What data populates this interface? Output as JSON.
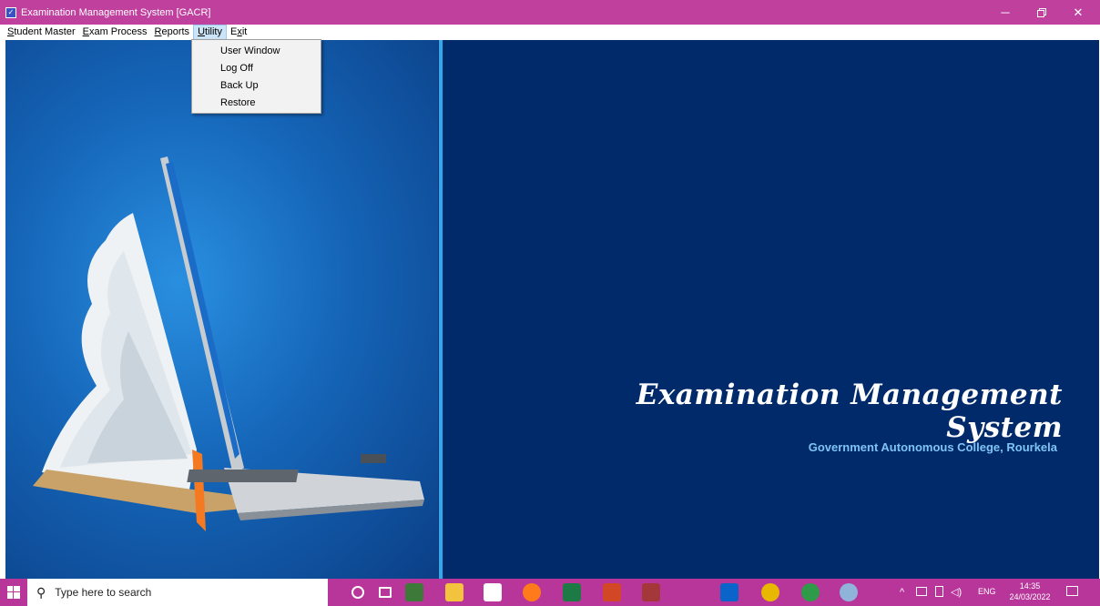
{
  "window": {
    "title": "Examination Management System  [GACR]",
    "controls": [
      "minimize-icon",
      "restore-icon",
      "close-icon"
    ]
  },
  "menubar": {
    "items": [
      {
        "label": "Student Master",
        "accelerator": "S"
      },
      {
        "label": "Exam Process",
        "accelerator": "E"
      },
      {
        "label": "Reports",
        "accelerator": "R"
      },
      {
        "label": "Utility",
        "accelerator": "U",
        "active": true
      },
      {
        "label": "Exit",
        "accelerator": "x"
      }
    ]
  },
  "utility_menu": {
    "items": [
      "User Window",
      "Log Off",
      "Back Up",
      "Restore"
    ]
  },
  "main": {
    "heading": "Examination Management System",
    "subheading": "Government Autonomous College, Rourkela"
  },
  "taskbar": {
    "search_placeholder": "Type here to search",
    "tray_language": "ENG",
    "clock_time": "14:35",
    "clock_date": "24/03/2022",
    "apps": [
      "cortana-icon",
      "task-view-icon",
      "app-icon",
      "file-explorer-icon",
      "store-icon",
      "firefox-icon",
      "excel-icon",
      "powerpoint-icon",
      "access-icon",
      "mail-icon",
      "chrome-icon",
      "chrome-icon",
      "paint-icon"
    ]
  },
  "colors": {
    "titlebar": "#c0409e",
    "taskbar": "#b8369a",
    "right_pane": "#012a6b",
    "subheading": "#7fc4f3"
  }
}
